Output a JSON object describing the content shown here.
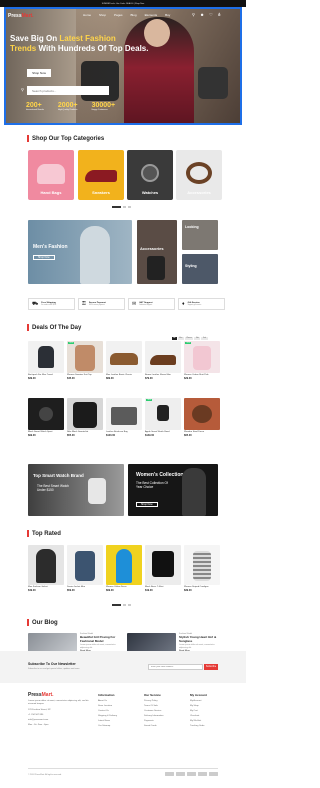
{
  "topbar": {
    "text": "SUMMER sale: Use Code: DEAL00 | Shop Now"
  },
  "header": {
    "logo_main": "Press",
    "logo_accent": "Mart.",
    "nav": [
      "Home",
      "Shop",
      "Pages",
      "Blog",
      "Elements",
      "Buy"
    ],
    "icons": [
      "search-icon",
      "user-icon",
      "heart-icon",
      "cart-icon"
    ]
  },
  "hero": {
    "title_1": "Save Big On ",
    "title_hl1": "Latest Fashion",
    "title_hl2": "Trends",
    "title_2": " With Hundreds Of Top Deals.",
    "button": "Shop Now",
    "search_placeholder": "Search products...",
    "stats": [
      {
        "num": "200+",
        "label": "International Brands"
      },
      {
        "num": "2000+",
        "label": "High-Quality Products"
      },
      {
        "num": "30000+",
        "label": "Happy Customers"
      }
    ]
  },
  "categories": {
    "title": "Shop Our Top Categories",
    "items": [
      "Hand Bags",
      "Sneakers",
      "Watches",
      "Accessories"
    ]
  },
  "promo": {
    "mens_title": "Men's Fashion",
    "mens_button": "Shop Now",
    "access_title": "Accessories",
    "looking_title": "Looking",
    "styling_title": "Styling"
  },
  "features": [
    {
      "icon": "truck-icon",
      "title": "Free Shipping",
      "sub": "For orders over $100"
    },
    {
      "icon": "lock-icon",
      "title": "Secure Payment",
      "sub": "100% secure payment"
    },
    {
      "icon": "chat-icon",
      "title": "24/7 Support",
      "sub": "Dedicated support"
    },
    {
      "icon": "gift-icon",
      "title": "Gift Service",
      "sub": "Support gift service"
    }
  ],
  "deals": {
    "title": "Deals Of The Day",
    "filters": [
      "All",
      "Men",
      "Women",
      "Kids",
      "Sale"
    ],
    "row1": [
      {
        "name": "Backpack For Men Travel",
        "price": "$39.00",
        "badge": ""
      },
      {
        "name": "Women Sweater Knit Top",
        "price": "$45.00",
        "badge": "-20%"
      },
      {
        "name": "Men Leather Boots Classic",
        "price": "$89.00",
        "badge": ""
      },
      {
        "name": "Brown Leather Shoes Men",
        "price": "$79.00",
        "badge": ""
      },
      {
        "name": "Women Cotton Shirt Pink",
        "price": "$29.00",
        "badge": "-15%"
      }
    ],
    "row2": [
      {
        "name": "Black Smart Watch Sport",
        "price": "$99.00",
        "badge": ""
      },
      {
        "name": "Nike Black Sweatshirt",
        "price": "$55.00",
        "badge": ""
      },
      {
        "name": "Leather Briefcase Bag",
        "price": "$120.00",
        "badge": ""
      },
      {
        "name": "Apple Smart Watch Band",
        "price": "$149.00",
        "badge": "-10%"
      },
      {
        "name": "Wooden Stool Decor",
        "price": "$65.00",
        "badge": ""
      }
    ]
  },
  "banners": {
    "watch_title": "Top Smart Watch Brand",
    "watch_sub": "The Best Smart Watch Under $150",
    "women_title": "Women's Collection",
    "women_sub": "The Best Collection Of Year Choice",
    "women_button": "Shop Now"
  },
  "top_rated": {
    "title": "Top Rated",
    "items": [
      {
        "name": "Men Fashion Jacket",
        "price": "$49.00"
      },
      {
        "name": "Denim Jacket Men",
        "price": "$59.00"
      },
      {
        "name": "Women Yellow Dress",
        "price": "$69.00"
      },
      {
        "name": "Black Basic T-Shirt",
        "price": "$19.00"
      },
      {
        "name": "Women Striped Cardigan",
        "price": "$39.00"
      }
    ]
  },
  "blog": {
    "title": "Our Blog",
    "posts": [
      {
        "author": "Fashion Model",
        "title": "Beautiful Girl Posing For Fashional Model",
        "excerpt": "Lorem ipsum dolor sit amet, consectetur adipiscing elit.",
        "more": "Read More"
      },
      {
        "author": "Fashion Model",
        "title": "Stylish Young Heart Girl & Sunglass",
        "excerpt": "Lorem ipsum dolor sit amet, consectetur adipiscing elit.",
        "more": "Read More"
      }
    ]
  },
  "newsletter": {
    "title": "Subscribe To Our Newsletter",
    "sub": "Subscribe to our and get special offers, updates and more.",
    "placeholder": "Enter your email address",
    "button": "Subscribe"
  },
  "footer": {
    "about": "Lorem ipsum dolor sit amet, consectetur adipiscing elit, sed do eiusmod tempor.",
    "contacts": [
      "123 Fashion Street, NY",
      "+1 234 567 890",
      "info@pressmart.com",
      "Mon - Fri: 9am - 6pm"
    ],
    "cols": [
      {
        "h": "Information",
        "items": [
          "About Us",
          "Store Location",
          "Contact Us",
          "Shipping & Delivery",
          "Latest News",
          "Our Sitemap"
        ]
      },
      {
        "h": "Our Service",
        "items": [
          "Privacy Policy",
          "Terms Of Sale",
          "Customer Service",
          "Delivery Information",
          "Payments",
          "Saved Cards"
        ]
      },
      {
        "h": "My Account",
        "items": [
          "My Account",
          "My Shop",
          "My Cart",
          "Checkout",
          "My Wishlist",
          "Tracking Order"
        ]
      }
    ],
    "copyright": "© 2024 PressMart. All rights reserved."
  }
}
